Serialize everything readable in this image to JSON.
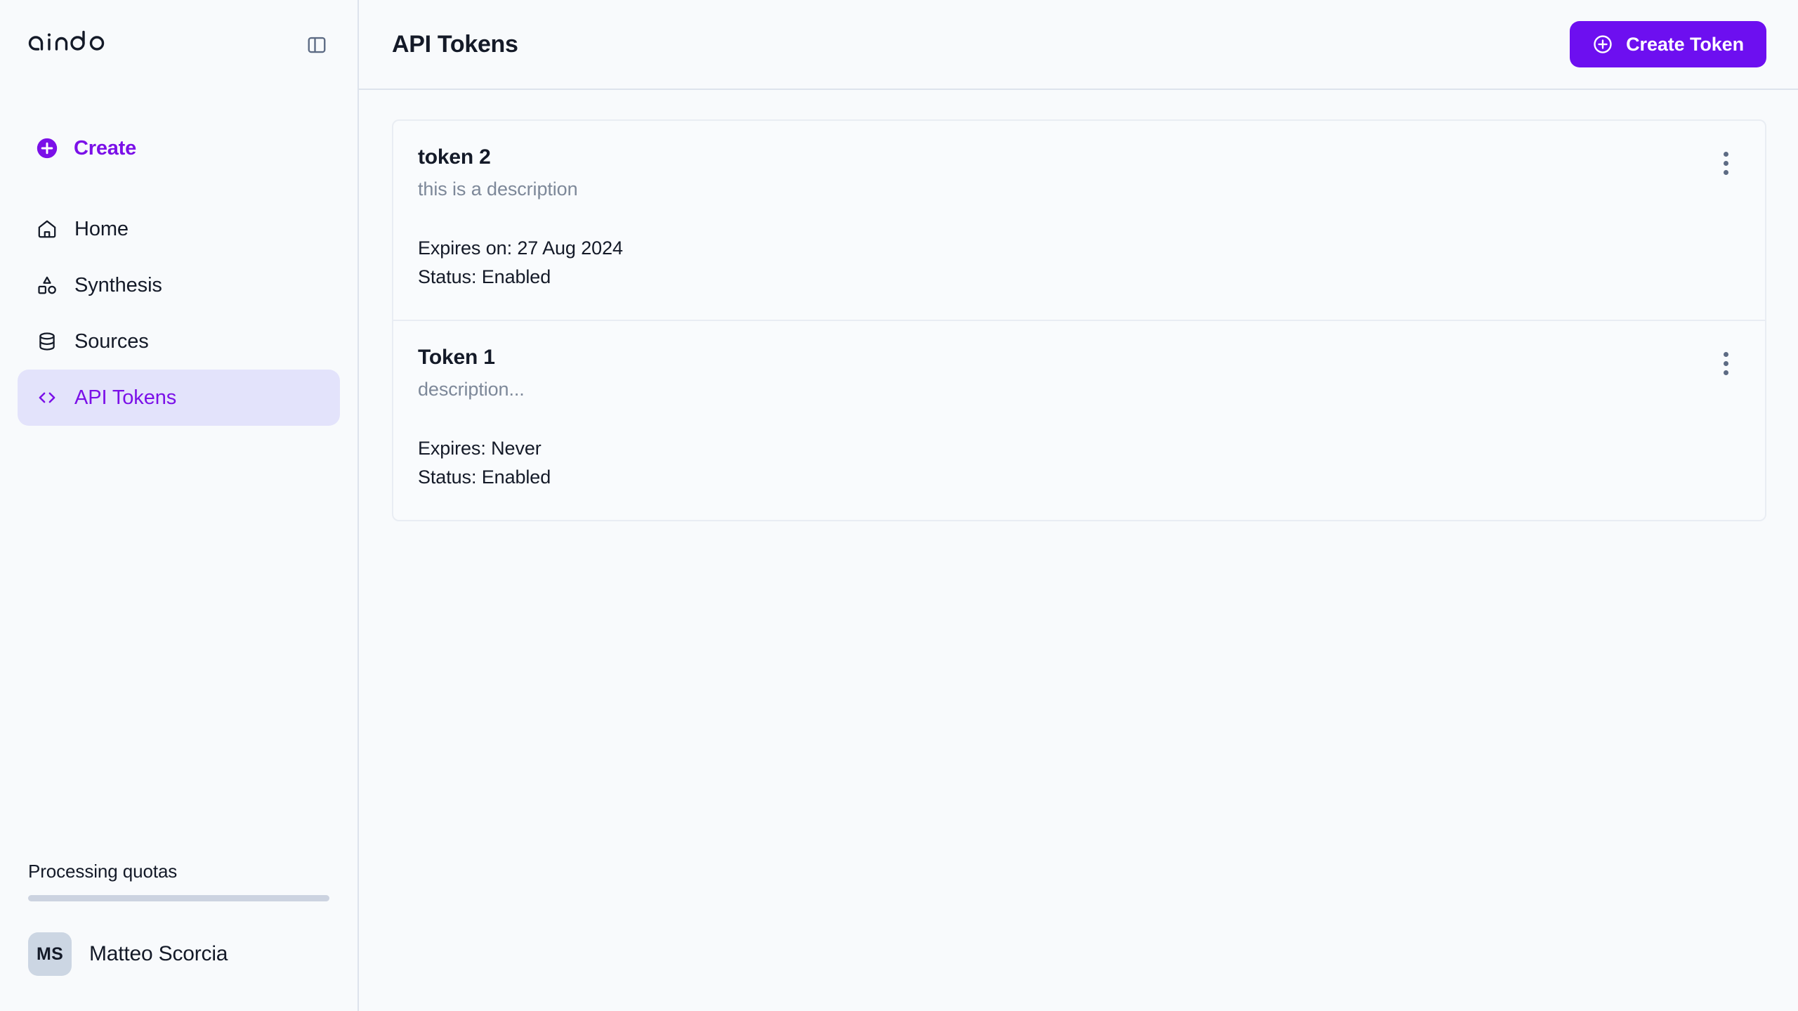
{
  "brand": {
    "name": "aindo",
    "collapse_icon": "panel-collapse-icon"
  },
  "sidebar": {
    "create": {
      "label": "Create",
      "icon": "plus-circle-icon"
    },
    "items": [
      {
        "label": "Home",
        "icon": "home-icon",
        "active": false
      },
      {
        "label": "Synthesis",
        "icon": "shapes-icon",
        "active": false
      },
      {
        "label": "Sources",
        "icon": "database-icon",
        "active": false
      },
      {
        "label": "API Tokens",
        "icon": "code-brackets-icon",
        "active": true
      }
    ],
    "quota": {
      "label": "Processing quotas",
      "percent": 0
    },
    "user": {
      "initials": "MS",
      "name": "Matteo Scorcia"
    }
  },
  "header": {
    "title": "API Tokens",
    "create_token_label": "Create Token",
    "create_token_icon": "plus-circle-outline-icon"
  },
  "tokens": [
    {
      "name": "token 2",
      "description": "this is a description",
      "expires": "Expires on: 27 Aug 2024",
      "status": "Status: Enabled",
      "menu_icon": "kebab-menu-icon"
    },
    {
      "name": "Token 1",
      "description": "description...",
      "expires": "Expires: Never",
      "status": "Status: Enabled",
      "menu_icon": "kebab-menu-icon"
    }
  ],
  "colors": {
    "accent": "#6d0ff0",
    "accent_text": "#7b10e8",
    "active_bg": "#e3e3fb",
    "page_bg": "#f8fafc",
    "border": "#dde3ec",
    "muted_text": "#7d8899",
    "ink": "#141a28"
  }
}
